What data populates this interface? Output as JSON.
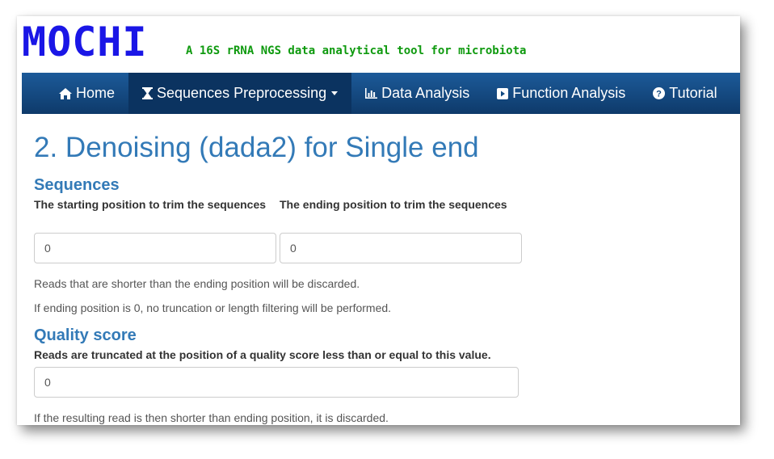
{
  "brand": {
    "logo": "MOCHI",
    "tagline": "A 16S rRNA NGS data analytical tool for microbiota"
  },
  "navbar": {
    "items": [
      {
        "label": "Home",
        "icon": "home-icon"
      },
      {
        "label": "Sequences Preprocessing",
        "icon": "hourglass-icon",
        "dropdown": true,
        "active": true
      },
      {
        "label": "Data Analysis",
        "icon": "bar-chart-icon"
      },
      {
        "label": "Function Analysis",
        "icon": "play-square-icon"
      },
      {
        "label": "Tutorial",
        "icon": "question-circle-icon"
      }
    ]
  },
  "page": {
    "title": "2. Denoising (dada2) for Single end",
    "sequences": {
      "heading": "Sequences",
      "start_label": "The starting position to trim the sequences",
      "start_value": "0",
      "end_label": "The ending position to trim the sequences",
      "end_value": "0",
      "help1": "Reads that are shorter than the ending position will be discarded.",
      "help2": "If ending position is 0, no truncation or length filtering will be performed."
    },
    "quality": {
      "heading": "Quality score",
      "label": "Reads are truncated at the position of a quality score less than or equal to this value.",
      "value": "0",
      "help": "If the resulting read is then shorter than ending position, it is discarded."
    }
  },
  "colors": {
    "logo": "#1a16e6",
    "tagline": "#0f9a0f",
    "navbar": "#1c5a99",
    "navbar_active": "#0b3360",
    "heading": "#337ab7"
  }
}
